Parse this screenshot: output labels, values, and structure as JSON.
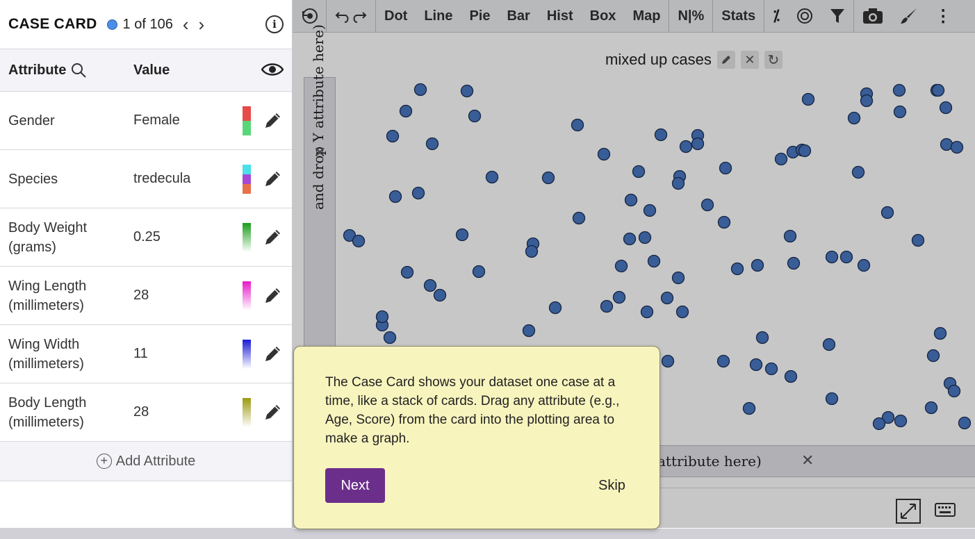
{
  "case_card": {
    "title": "CASE CARD",
    "case_counter": "1 of 106",
    "attribute_header": "Attribute",
    "value_header": "Value",
    "attributes": [
      {
        "name": "Gender",
        "value": "Female",
        "swatch_colors": [
          "#e84a4a",
          "#5ad67a"
        ]
      },
      {
        "name": "Species",
        "value": "tredecula",
        "swatch_colors": [
          "#4ae0e8",
          "#a64ad6",
          "#e8704a"
        ]
      },
      {
        "name": "Body Weight (grams)",
        "value": "0.25",
        "swatch_colors": [
          "#1a9e1a",
          "#ffffff"
        ]
      },
      {
        "name": "Wing Length (millimeters)",
        "value": "28",
        "swatch_colors": [
          "#e61ac8",
          "#ffffff"
        ]
      },
      {
        "name": "Wing Width (millimeters)",
        "value": "11",
        "swatch_colors": [
          "#1a1ad6",
          "#ffffff"
        ]
      },
      {
        "name": "Body Length (millimeters)",
        "value": "28",
        "swatch_colors": [
          "#9a9a10",
          "#ffffff"
        ]
      }
    ],
    "add_attribute_label": "Add Attribute"
  },
  "toolbar": {
    "items": [
      "Dot",
      "Line",
      "Pie",
      "Bar",
      "Hist",
      "Box",
      "Map",
      "N|%",
      "Stats"
    ]
  },
  "graph": {
    "title": "mixed up cases",
    "y_label": "and drop Y attribute here)",
    "x_label": "attribute here)",
    "point_color": "#4a78c0"
  },
  "tour": {
    "text": "The Case Card shows your dataset one case at a time, like a stack of cards. Drag any attribute (e.g., Age, Score) from the card into the plotting area to make a graph.",
    "next_label": "Next",
    "skip_label": "Skip"
  }
}
